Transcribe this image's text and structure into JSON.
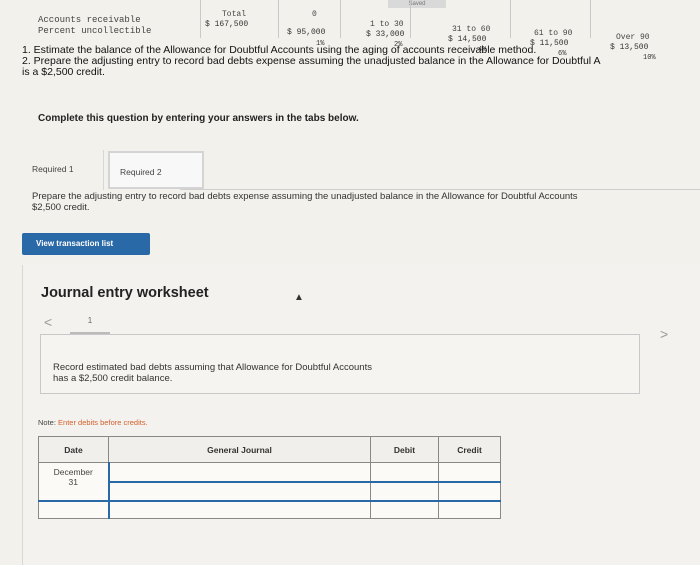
{
  "aging": {
    "row1_label": "Accounts receivable",
    "row2_label": "Percent uncollectible",
    "saved_label": "Saved",
    "columns": [
      {
        "header": "Total",
        "amount": "$ 167,500",
        "percent": ""
      },
      {
        "header": "0",
        "amount": "$ 95,000",
        "percent": "1%"
      },
      {
        "header": "1 to 30",
        "amount": "$ 33,000",
        "percent": "2%"
      },
      {
        "header": "31 to 60",
        "amount": "$ 14,500",
        "percent": "4%"
      },
      {
        "header": "61 to 90",
        "amount": "$ 11,500",
        "percent": "6%"
      },
      {
        "header": "Over 90",
        "amount": "$ 13,500",
        "percent": "10%"
      }
    ]
  },
  "instructions": {
    "line1": "1. Estimate the balance of the Allowance for Doubtful Accounts using the aging of accounts receivable method.",
    "line2": "2. Prepare the adjusting entry to record bad debts expense assuming the unadjusted balance in the Allowance for Doubtful A",
    "line3": "is a $2,500 credit."
  },
  "complete_text": "Complete this question by entering your answers in the tabs below.",
  "tabs": [
    {
      "label": "Required 1"
    },
    {
      "label": "Required 2"
    }
  ],
  "prepare": {
    "line1": "Prepare the adjusting entry to record bad debts expense assuming the unadjusted balance in the Allowance for Doubtful Accounts",
    "line2": "$2,500 credit."
  },
  "view_transaction_label": "View transaction list",
  "worksheet": {
    "title": "Journal entry worksheet",
    "prev_icon": "<",
    "next_icon": ">",
    "page": "1",
    "record_line1": "Record estimated bad debts assuming that Allowance for Doubtful Accounts",
    "record_line2": "has a $2,500 credit balance.",
    "note_label": "Note:",
    "note_text": "Enter debits before credits."
  },
  "journal": {
    "headers": {
      "date": "Date",
      "general": "General Journal",
      "debit": "Debit",
      "credit": "Credit"
    },
    "date_month": "December",
    "date_day": "31"
  },
  "colors": {
    "accent": "#2a69a8",
    "note": "#d35f2c"
  }
}
